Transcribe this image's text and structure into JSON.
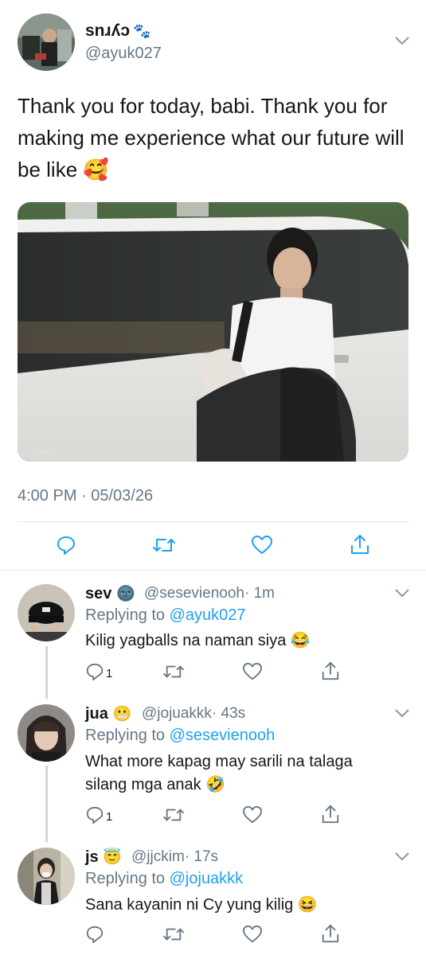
{
  "main_tweet": {
    "display_name": "snɹʎɔ",
    "name_emoji": "🐾",
    "handle": "@ayuk027",
    "text": "Thank you for today, babi. Thank you for making me experience what our future will be like 🥰",
    "timestamp": "4:00 PM · 05/03/26"
  },
  "replies": [
    {
      "name": "sev",
      "name_emoji": "🌚",
      "handle": "@sesevienooh",
      "time": "· 1m",
      "replying_label": "Replying to",
      "replying_to": "@ayuk027",
      "text": "Kilig yagballs na naman siya 😂",
      "reply_count": "1"
    },
    {
      "name": "jua",
      "name_emoji": "😬",
      "handle": "@jojuakkk",
      "time": "· 43s",
      "replying_label": "Replying to",
      "replying_to": "@sesevienooh",
      "text_line1": "What more kapag may sarili na talaga",
      "text_line2": "silang mga anak 🤣",
      "reply_count": "1"
    },
    {
      "name": "js",
      "name_emoji": "😇",
      "handle": "@jjckim",
      "time": "· 17s",
      "replying_label": "Replying to",
      "replying_to": "@jojuakkk",
      "text": "Sana kayanin ni Cy yung kilig 😆"
    }
  ],
  "icons": [
    "chevron-down-icon",
    "reply-icon",
    "retweet-icon",
    "like-icon",
    "share-icon"
  ],
  "colors": {
    "link": "#1da1f2",
    "muted": "#657786",
    "divider": "#e1e8ed",
    "thread": "#ccd6dd"
  }
}
